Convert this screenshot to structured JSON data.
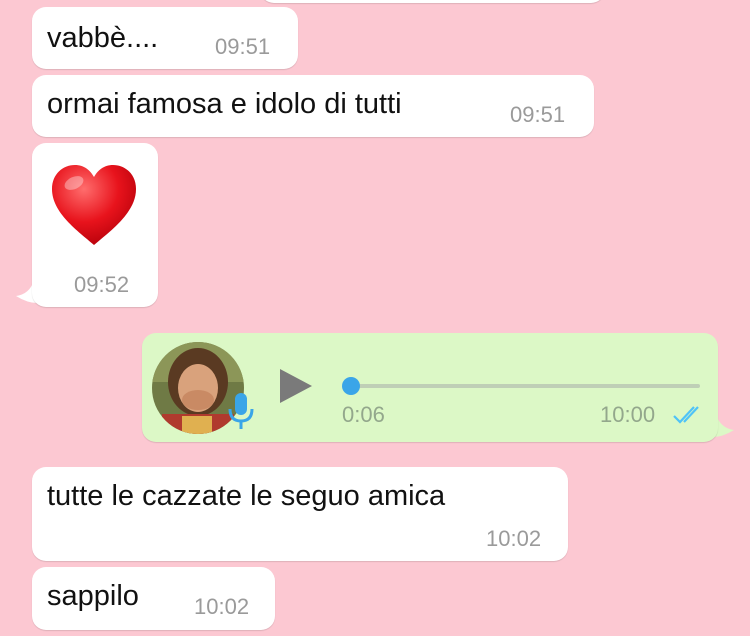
{
  "messages": [
    {
      "text": "vabbè....",
      "time": "09:51"
    },
    {
      "text": "ormai famosa e idolo di tutti",
      "time": "09:51"
    },
    {
      "emoji": "heart-emoji",
      "time": "09:52"
    },
    {
      "voice": {
        "duration": "0:06",
        "time": "10:00",
        "progress": 0.0,
        "status": "read",
        "icons": [
          "play-icon",
          "microphone-icon",
          "double-check-icon"
        ]
      }
    },
    {
      "text": "tutte le cazzate le seguo amica",
      "time": "10:02"
    },
    {
      "text": "sappilo",
      "time": "10:02"
    }
  ],
  "colors": {
    "background": "#fcc8d2",
    "incoming_bubble": "#ffffff",
    "outgoing_bubble": "#dcf8c6",
    "read_ticks": "#4fc3f7",
    "progress_dot": "#3aa5e8"
  }
}
